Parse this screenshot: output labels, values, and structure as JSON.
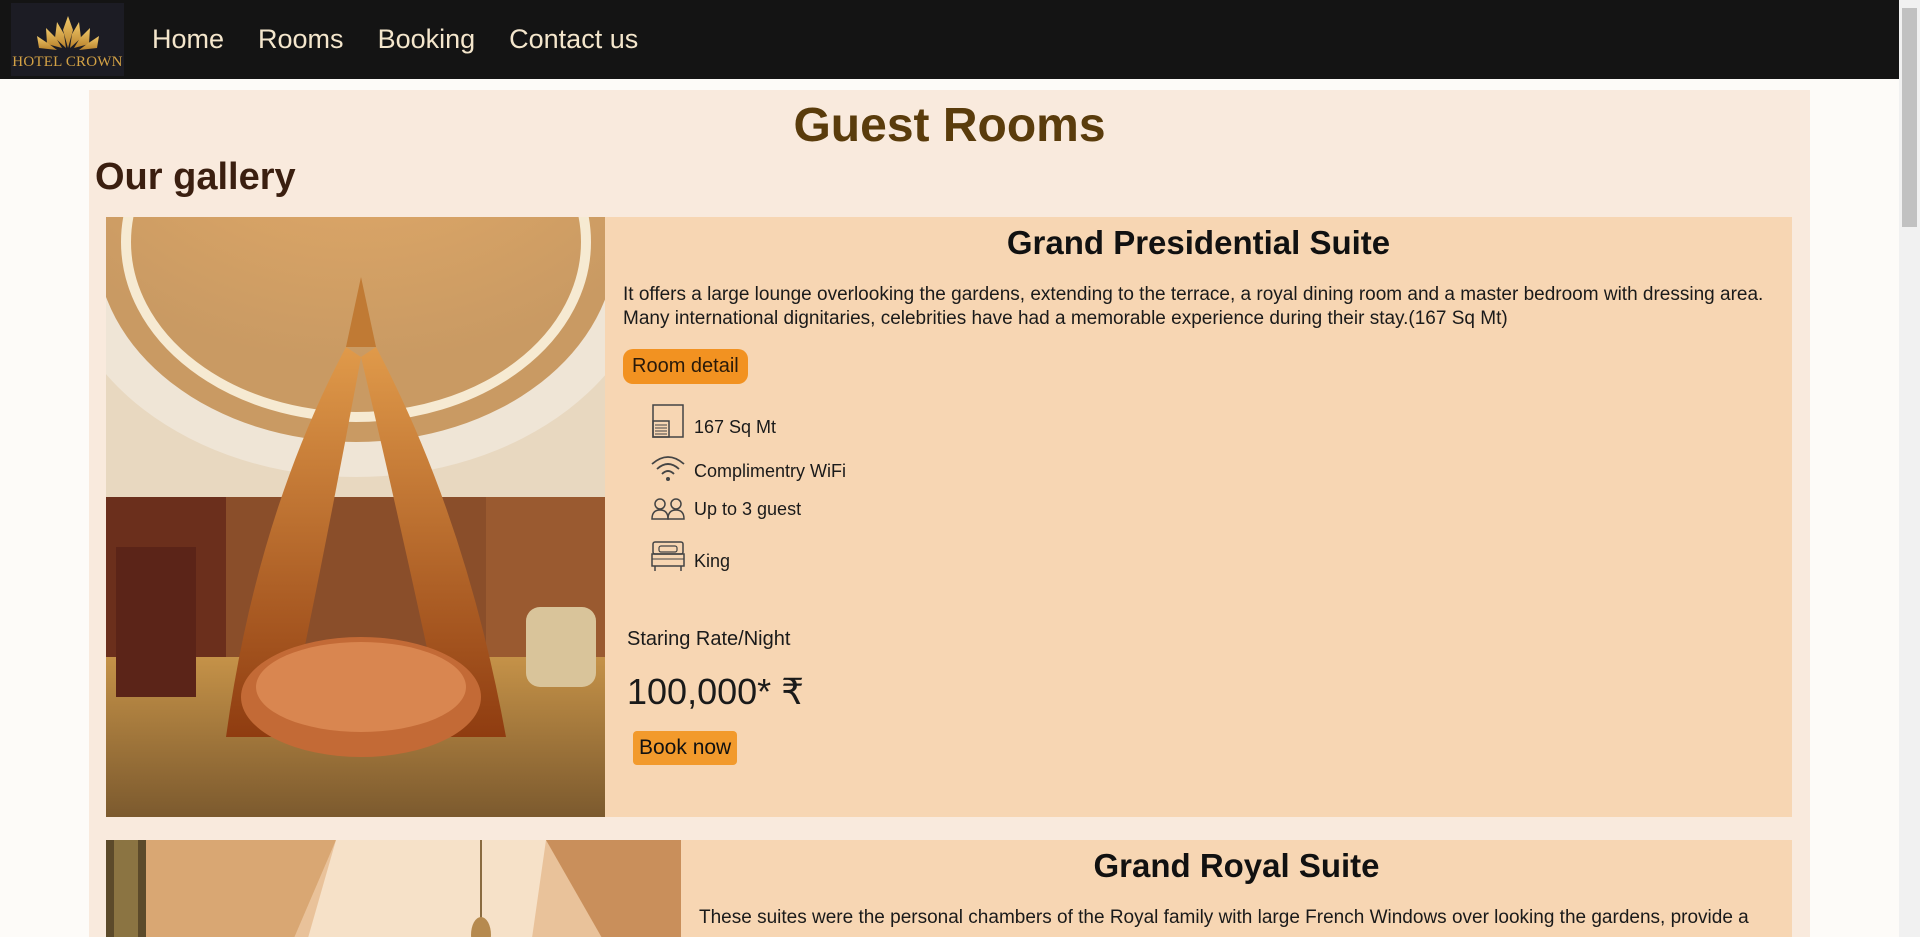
{
  "nav": {
    "logo_text": "HOTEL CROWN",
    "links": [
      "Home",
      "Rooms",
      "Booking",
      "Contact us"
    ]
  },
  "page": {
    "title": "Guest Rooms",
    "gallery_title": "Our gallery"
  },
  "rooms": [
    {
      "name": "Grand Presidential Suite",
      "description": "It offers a large lounge overlooking the gardens, extending to the terrace, a royal dining room and a master bedroom with dressing area. Many international dignitaries, celebrities have had a memorable experience during their stay.(167 Sq Mt)",
      "detail_label": "Room detail",
      "amenities": [
        {
          "icon": "floor-plan-icon",
          "label": "167 Sq Mt"
        },
        {
          "icon": "wifi-icon",
          "label": "Complimentry WiFi"
        },
        {
          "icon": "guests-icon",
          "label": "Up to 3 guest"
        },
        {
          "icon": "bed-icon",
          "label": "King"
        }
      ],
      "rate_label": "Staring Rate/Night",
      "rate_value": "100,000* ₹",
      "book_label": "Book now"
    },
    {
      "name": "Grand Royal Suite",
      "description": "These suites were the personal chambers of the Royal family with large French Windows over looking the gardens, provide a"
    }
  ],
  "colors": {
    "navbar": "#141414",
    "nav_text": "#f4e6cc",
    "accent": "#f29221",
    "card": "#f7d6b3",
    "container": "#f9eadd",
    "title": "#5a3c0c"
  }
}
